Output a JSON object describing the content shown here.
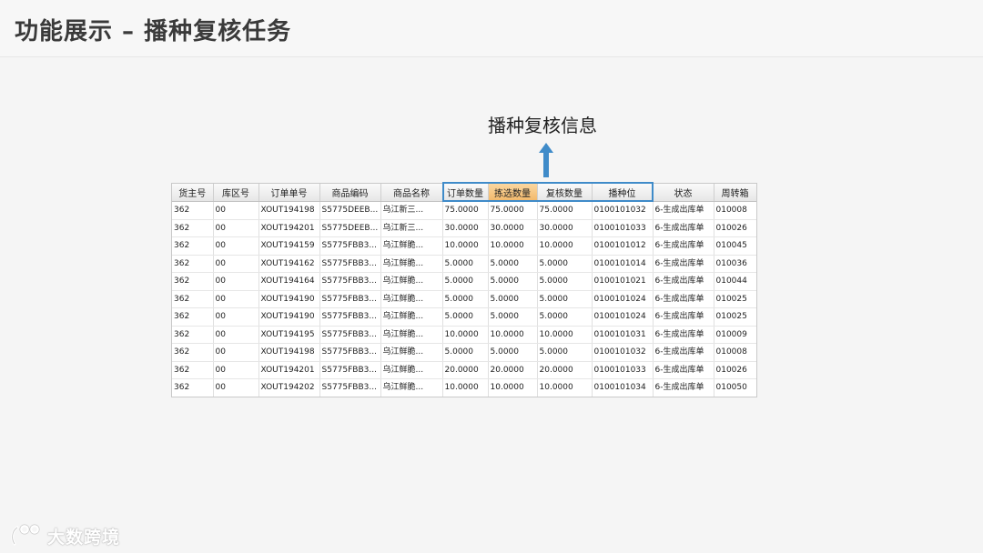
{
  "slide": {
    "title": "功能展示 – 播种复核任务",
    "callout": "播种复核信息"
  },
  "logo": {
    "text": "大数跨境",
    "icon": "people-logo-icon"
  },
  "colors": {
    "highlight_border": "#3f8bc9",
    "highlight_header": "#f2b86a",
    "arrow": "#3f8bc9"
  },
  "grid": {
    "columns": [
      "货主号",
      "库区号",
      "订单单号",
      "商品编码",
      "商品名称",
      "订单数量",
      "拣选数量",
      "复核数量",
      "播种位",
      "状态",
      "周转箱"
    ],
    "highlighted_column": "拣选数量",
    "rows": [
      [
        "362",
        "00",
        "XOUT194198",
        "S5775DEEB...",
        "乌江新三...",
        "75.0000",
        "75.0000",
        "75.0000",
        "0100101032",
        "6-生成出库单",
        "010008"
      ],
      [
        "362",
        "00",
        "XOUT194201",
        "S5775DEEB...",
        "乌江新三...",
        "30.0000",
        "30.0000",
        "30.0000",
        "0100101033",
        "6-生成出库单",
        "010026"
      ],
      [
        "362",
        "00",
        "XOUT194159",
        "S5775FBB3...",
        "乌江鲜脆...",
        "10.0000",
        "10.0000",
        "10.0000",
        "0100101012",
        "6-生成出库单",
        "010045"
      ],
      [
        "362",
        "00",
        "XOUT194162",
        "S5775FBB3...",
        "乌江鲜脆...",
        "5.0000",
        "5.0000",
        "5.0000",
        "0100101014",
        "6-生成出库单",
        "010036"
      ],
      [
        "362",
        "00",
        "XOUT194164",
        "S5775FBB3...",
        "乌江鲜脆...",
        "5.0000",
        "5.0000",
        "5.0000",
        "0100101021",
        "6-生成出库单",
        "010044"
      ],
      [
        "362",
        "00",
        "XOUT194190",
        "S5775FBB3...",
        "乌江鲜脆...",
        "5.0000",
        "5.0000",
        "5.0000",
        "0100101024",
        "6-生成出库单",
        "010025"
      ],
      [
        "362",
        "00",
        "XOUT194190",
        "S5775FBB3...",
        "乌江鲜脆...",
        "5.0000",
        "5.0000",
        "5.0000",
        "0100101024",
        "6-生成出库单",
        "010025"
      ],
      [
        "362",
        "00",
        "XOUT194195",
        "S5775FBB3...",
        "乌江鲜脆...",
        "10.0000",
        "10.0000",
        "10.0000",
        "0100101031",
        "6-生成出库单",
        "010009"
      ],
      [
        "362",
        "00",
        "XOUT194198",
        "S5775FBB3...",
        "乌江鲜脆...",
        "5.0000",
        "5.0000",
        "5.0000",
        "0100101032",
        "6-生成出库单",
        "010008"
      ],
      [
        "362",
        "00",
        "XOUT194201",
        "S5775FBB3...",
        "乌江鲜脆...",
        "20.0000",
        "20.0000",
        "20.0000",
        "0100101033",
        "6-生成出库单",
        "010026"
      ],
      [
        "362",
        "00",
        "XOUT194202",
        "S5775FBB3...",
        "乌江鲜脆...",
        "10.0000",
        "10.0000",
        "10.0000",
        "0100101034",
        "6-生成出库单",
        "010050"
      ]
    ]
  }
}
